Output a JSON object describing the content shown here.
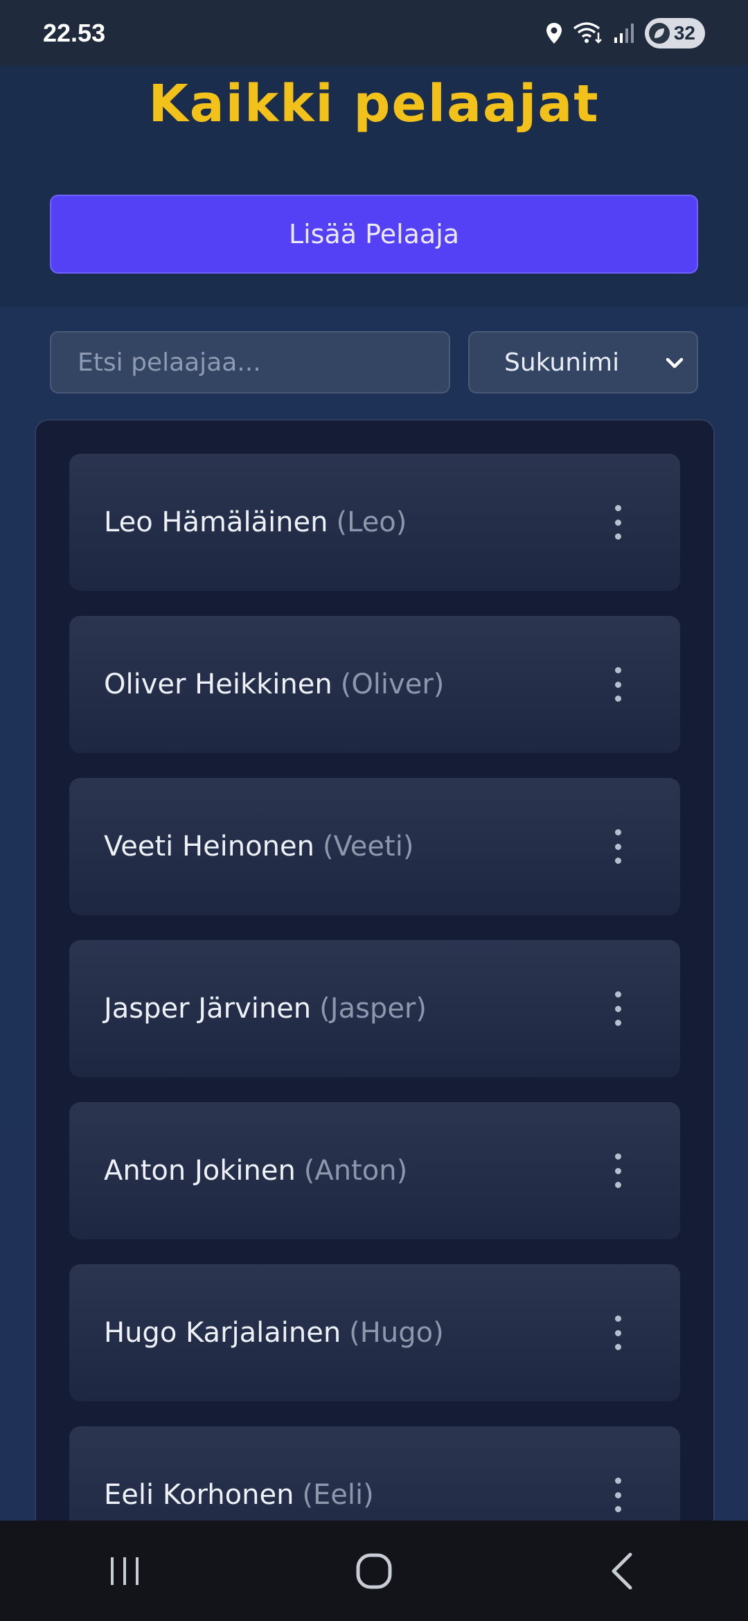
{
  "status_bar": {
    "time": "22.53",
    "battery": "32",
    "icons": [
      "location-icon",
      "wifi-icon",
      "signal-icon",
      "battery-saver-icon"
    ]
  },
  "header": {
    "title": "Kaikki pelaajat",
    "add_button": "Lisää Pelaaja"
  },
  "search": {
    "placeholder": "Etsi pelaajaa..."
  },
  "sort": {
    "selected": "Sukunimi"
  },
  "players": [
    {
      "name": "Leo Hämäläinen",
      "nick": "(Leo)"
    },
    {
      "name": "Oliver Heikkinen",
      "nick": "(Oliver)"
    },
    {
      "name": "Veeti Heinonen",
      "nick": "(Veeti)"
    },
    {
      "name": "Jasper Järvinen",
      "nick": "(Jasper)"
    },
    {
      "name": "Anton Jokinen",
      "nick": "(Anton)"
    },
    {
      "name": "Hugo Karjalainen",
      "nick": "(Hugo)"
    },
    {
      "name": "Eeli Korhonen",
      "nick": "(Eeli)"
    }
  ],
  "colors": {
    "title": "#f3c21a",
    "accent_button": "#5441f5",
    "background": "#1e3157",
    "card": "#242f4a"
  }
}
